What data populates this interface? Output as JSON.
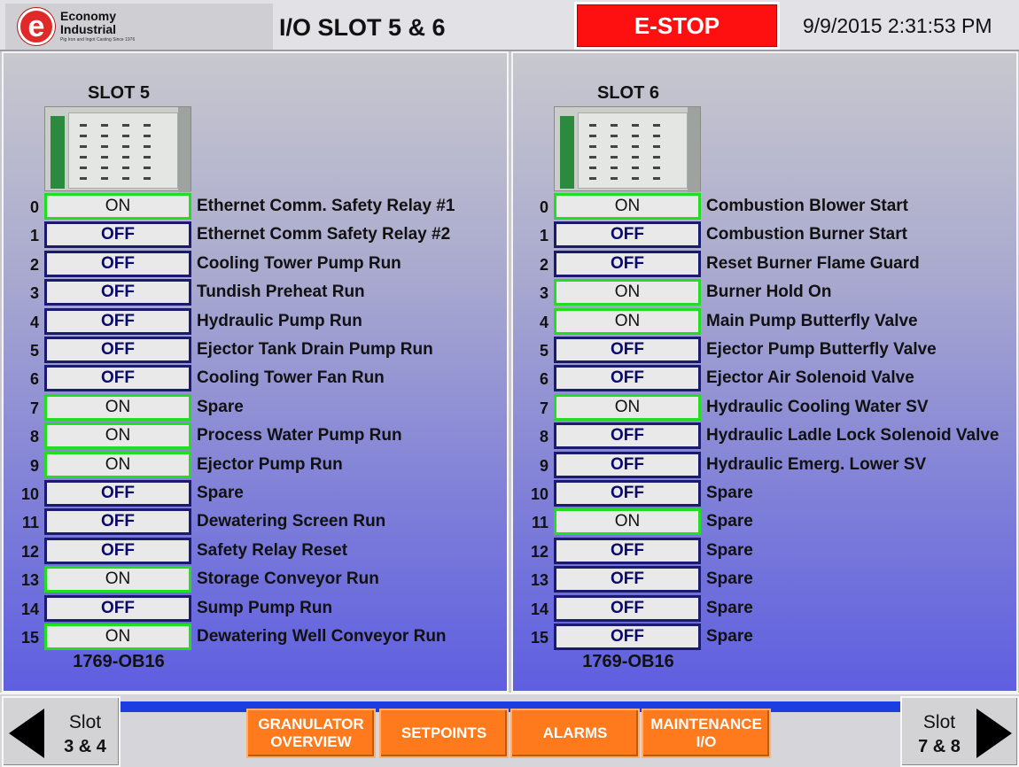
{
  "header": {
    "logo": {
      "line1": "Economy",
      "line2": "Industrial",
      "tagline": "Pig Iron and Ingot Casting Since 1976",
      "mark": "e"
    },
    "title": "I/O SLOT 5 & 6",
    "estop_label": "E-STOP",
    "datetime": "9/9/2015 2:31:53 PM"
  },
  "colors": {
    "on_border": "#22dd22",
    "off_border": "#1a1a6e",
    "estop": "#ff1010",
    "menu": "#ff7a1c"
  },
  "slots": [
    {
      "title": "SLOT 5",
      "part": "1769-OB16",
      "channels": [
        {
          "idx": "0",
          "state": "ON",
          "desc": "Ethernet Comm. Safety Relay #1"
        },
        {
          "idx": "1",
          "state": "OFF",
          "desc": "Ethernet Comm Safety Relay #2"
        },
        {
          "idx": "2",
          "state": "OFF",
          "desc": "Cooling Tower Pump Run"
        },
        {
          "idx": "3",
          "state": "OFF",
          "desc": "Tundish Preheat Run"
        },
        {
          "idx": "4",
          "state": "OFF",
          "desc": "Hydraulic Pump Run"
        },
        {
          "idx": "5",
          "state": "OFF",
          "desc": "Ejector Tank Drain Pump Run"
        },
        {
          "idx": "6",
          "state": "OFF",
          "desc": "Cooling Tower Fan Run"
        },
        {
          "idx": "7",
          "state": "ON",
          "desc": "Spare"
        },
        {
          "idx": "8",
          "state": "ON",
          "desc": "Process Water Pump Run"
        },
        {
          "idx": "9",
          "state": "ON",
          "desc": "Ejector Pump Run"
        },
        {
          "idx": "10",
          "state": "OFF",
          "desc": "Spare"
        },
        {
          "idx": "11",
          "state": "OFF",
          "desc": "Dewatering Screen Run"
        },
        {
          "idx": "12",
          "state": "OFF",
          "desc": "Safety Relay Reset"
        },
        {
          "idx": "13",
          "state": "ON",
          "desc": "Storage Conveyor Run"
        },
        {
          "idx": "14",
          "state": "OFF",
          "desc": "Sump Pump Run"
        },
        {
          "idx": "15",
          "state": "ON",
          "desc": "Dewatering Well Conveyor Run"
        }
      ]
    },
    {
      "title": "SLOT 6",
      "part": "1769-OB16",
      "channels": [
        {
          "idx": "0",
          "state": "ON",
          "desc": "Combustion Blower Start"
        },
        {
          "idx": "1",
          "state": "OFF",
          "desc": "Combustion Burner Start"
        },
        {
          "idx": "2",
          "state": "OFF",
          "desc": "Reset Burner Flame Guard"
        },
        {
          "idx": "3",
          "state": "ON",
          "desc": "Burner Hold On"
        },
        {
          "idx": "4",
          "state": "ON",
          "desc": "Main Pump Butterfly Valve"
        },
        {
          "idx": "5",
          "state": "OFF",
          "desc": "Ejector Pump Butterfly Valve"
        },
        {
          "idx": "6",
          "state": "OFF",
          "desc": "Ejector Air Solenoid Valve"
        },
        {
          "idx": "7",
          "state": "ON",
          "desc": "Hydraulic Cooling Water SV"
        },
        {
          "idx": "8",
          "state": "OFF",
          "desc": "Hydraulic Ladle Lock Solenoid Valve"
        },
        {
          "idx": "9",
          "state": "OFF",
          "desc": "Hydraulic Emerg. Lower SV"
        },
        {
          "idx": "10",
          "state": "OFF",
          "desc": "Spare"
        },
        {
          "idx": "11",
          "state": "ON",
          "desc": "Spare"
        },
        {
          "idx": "12",
          "state": "OFF",
          "desc": "Spare"
        },
        {
          "idx": "13",
          "state": "OFF",
          "desc": "Spare"
        },
        {
          "idx": "14",
          "state": "OFF",
          "desc": "Spare"
        },
        {
          "idx": "15",
          "state": "OFF",
          "desc": "Spare"
        }
      ]
    }
  ],
  "footer": {
    "prev": {
      "line1": "Slot",
      "line2": "3 & 4",
      "icon": "arrow-left-icon"
    },
    "next": {
      "line1": "Slot",
      "line2": "7 & 8",
      "icon": "arrow-right-icon"
    },
    "menu": [
      {
        "label": "GRANULATOR OVERVIEW"
      },
      {
        "label": "SETPOINTS"
      },
      {
        "label": "ALARMS"
      },
      {
        "label": "MAINTENANCE I/O"
      }
    ]
  }
}
